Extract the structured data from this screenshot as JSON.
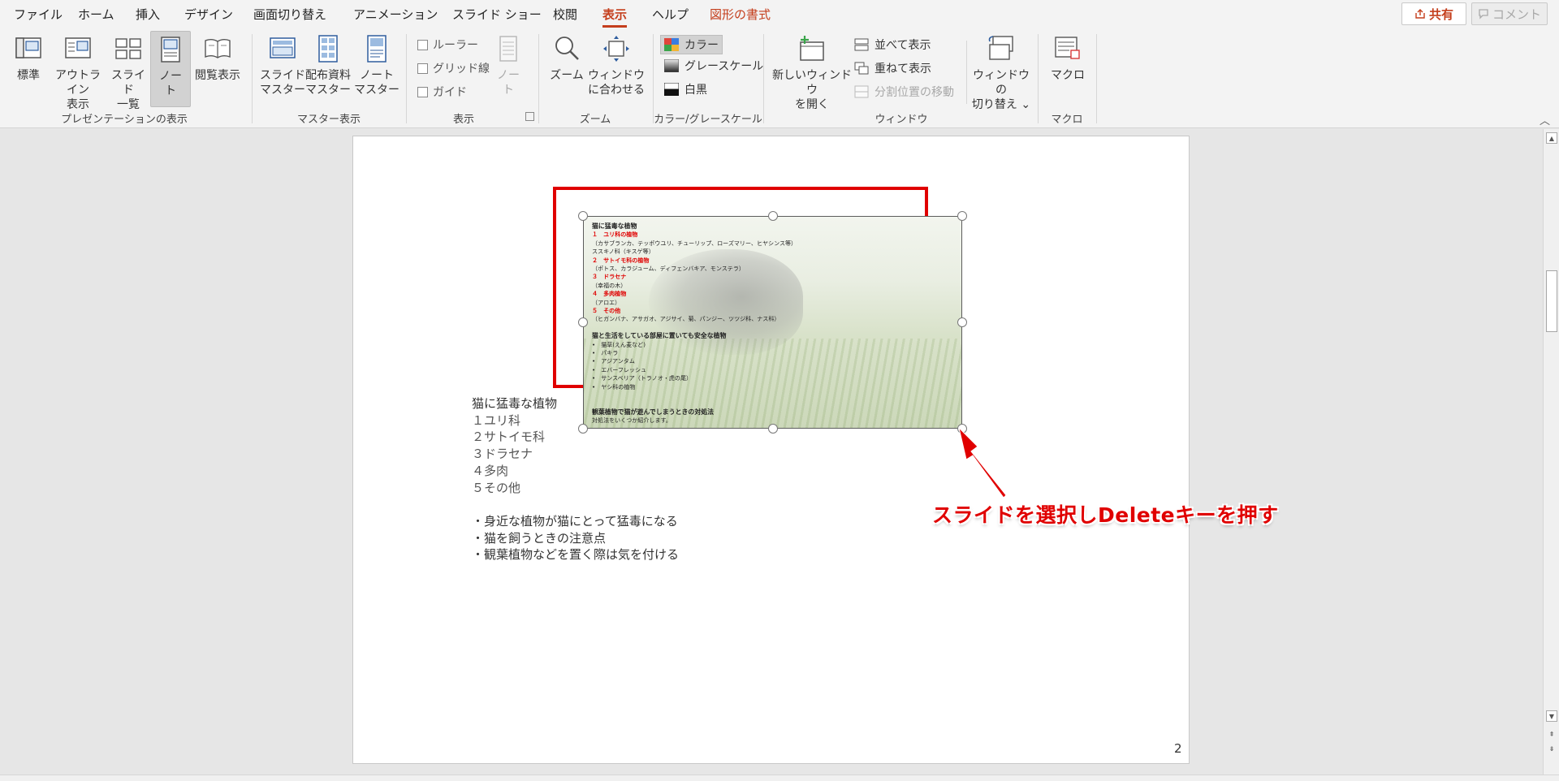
{
  "menu": {
    "tabs": [
      "ファイル",
      "ホーム",
      "挿入",
      "デザイン",
      "画面切り替え",
      "アニメーション",
      "スライド ショー",
      "校閲",
      "表示",
      "ヘルプ",
      "図形の書式"
    ],
    "active_tab": "表示",
    "share_label": "共有",
    "comment_label": "コメント"
  },
  "ribbon": {
    "groups": {
      "presentation_views": "プレゼンテーションの表示",
      "master_views": "マスター表示",
      "show": "表示",
      "zoom": "ズーム",
      "color_grayscale": "カラー/グレースケール",
      "window": "ウィンドウ",
      "macro": "マクロ"
    },
    "buttons": {
      "normal": "標準",
      "outline": "アウトライン\n表示",
      "slide_sorter": "スライド\n一覧",
      "notes_page": "ノー\nト",
      "reading_view": "閲覧表示",
      "slide_master": "スライド\nマスター",
      "handout_master": "配布資料\nマスター",
      "notes_master": "ノート\nマスター",
      "notes_disabled": "ノー\nト",
      "zoom": "ズーム",
      "fit_window": "ウィンドウ\nに合わせる",
      "new_window": "新しいウィンドウ\nを開く",
      "switch_window": "ウィンドウの\n切り替え ⌄",
      "macro": "マクロ"
    },
    "checks": {
      "ruler": "ルーラー",
      "gridlines": "グリッド線",
      "guides": "ガイド"
    },
    "color_options": {
      "color": "カラー",
      "grayscale": "グレースケール",
      "bw": "白黒"
    },
    "window_options": {
      "arrange_all": "並べて表示",
      "cascade": "重ねて表示",
      "move_split": "分割位置の移動"
    }
  },
  "slide_thumbnail": {
    "lines": [
      {
        "text": "猫に猛毒な植物",
        "style": "head"
      },
      {
        "text": "１　ユリ科の植物",
        "style": "red"
      },
      {
        "text": "（カサブランカ、テッポウユリ、チューリップ、ローズマリー、ヒヤシンス等）",
        "style": "normal"
      },
      {
        "text": "ススキノ科（キスゲ等）",
        "style": "normal"
      },
      {
        "text": "２　サトイモ科の植物",
        "style": "red"
      },
      {
        "text": "（ポトス、カラジューム、ディフェンバキア、モンステラ）",
        "style": "normal"
      },
      {
        "text": "３　ドラセナ",
        "style": "red"
      },
      {
        "text": "（幸福の木）",
        "style": "normal"
      },
      {
        "text": "４　多肉植物",
        "style": "red"
      },
      {
        "text": "（アロエ）",
        "style": "normal"
      },
      {
        "text": "５　その他",
        "style": "red"
      },
      {
        "text": "（ヒガンバナ、アサガオ、アジサイ、菊、パンジー、ツツジ科、ナス科）",
        "style": "normal"
      },
      {
        "text": "",
        "style": "normal"
      },
      {
        "text": "猫と生活をしている部屋に置いても安全な植物",
        "style": "head"
      },
      {
        "text": "•　猫草(えん麦など)",
        "style": "normal"
      },
      {
        "text": "•　パキラ",
        "style": "normal"
      },
      {
        "text": "•　アジアンタム",
        "style": "normal"
      },
      {
        "text": "•　エバーフレッシュ",
        "style": "normal"
      },
      {
        "text": "•　サンスベリア（トラノオ・虎の尾）",
        "style": "normal"
      },
      {
        "text": "•　ヤシ科の植物",
        "style": "normal"
      },
      {
        "text": "",
        "style": "normal"
      },
      {
        "text": "",
        "style": "normal"
      },
      {
        "text": "観葉植物で猫が遊んでしまうときの対処法",
        "style": "head"
      },
      {
        "text": "対処法をいくつか紹介します。",
        "style": "normal"
      }
    ]
  },
  "notes": {
    "lines": [
      "猫に猛毒な植物",
      "１ユリ科",
      "２サトイモ科",
      "３ドラセナ",
      "４多肉",
      "５その他",
      "",
      "・身近な植物が猫にとって猛毒になる",
      "・猫を飼うときの注意点",
      "・観葉植物などを置く際は気を付ける"
    ]
  },
  "page_number": "2",
  "annotation": "スライドを選択しDeleteキーを押す",
  "colors": {
    "accent": "#c43e1c",
    "highlight_red": "#e00000",
    "ribbon_bg": "#f3f3f3",
    "workspace_bg": "#e6e6e6"
  }
}
